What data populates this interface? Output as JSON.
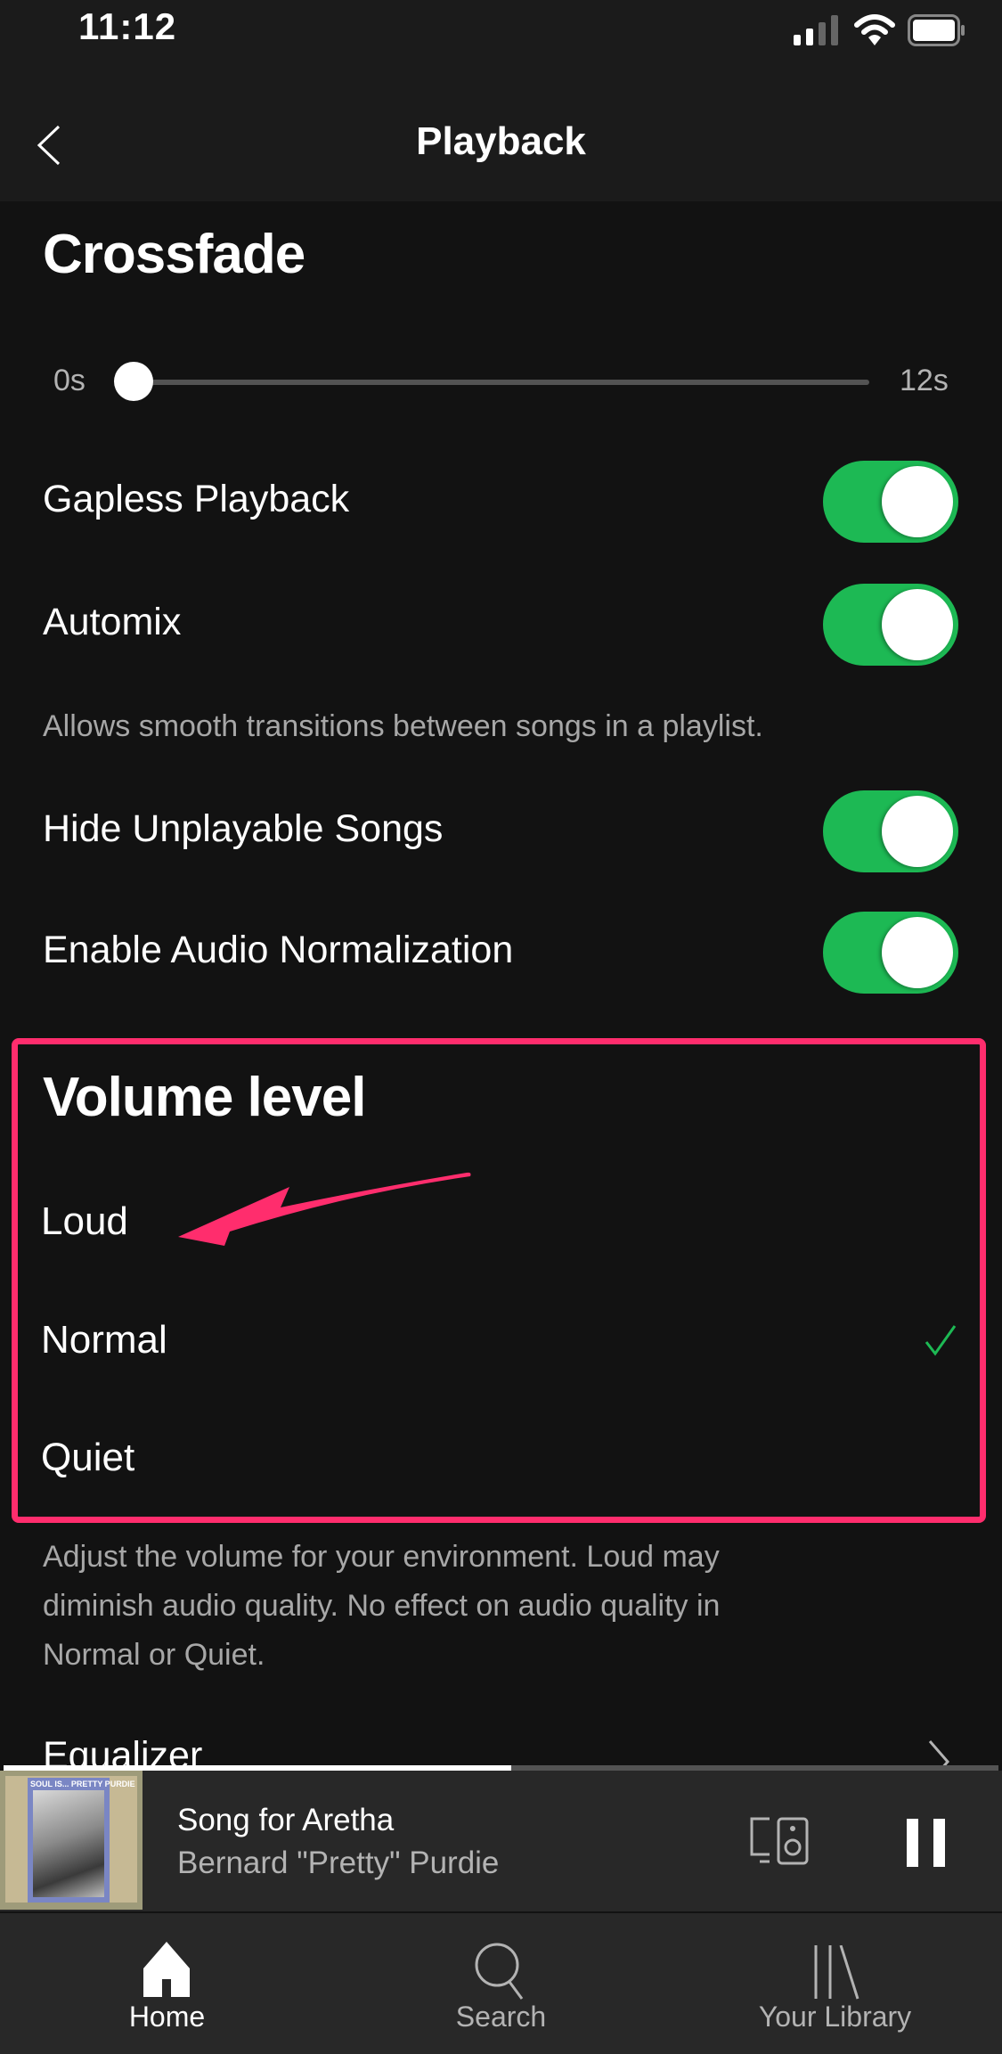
{
  "status_bar": {
    "time": "11:12",
    "icons": [
      "cellular-signal-icon",
      "wifi-icon",
      "battery-icon"
    ]
  },
  "nav": {
    "title": "Playback",
    "back_icon": "chevron-left-icon"
  },
  "crossfade": {
    "heading": "Crossfade",
    "min_label": "0s",
    "max_label": "12s",
    "value_seconds": 0,
    "max_seconds": 12
  },
  "toggles": [
    {
      "label": "Gapless Playback",
      "on": true
    },
    {
      "label": "Automix",
      "on": true,
      "description": "Allows smooth transitions between songs in a playlist."
    },
    {
      "label": "Hide Unplayable Songs",
      "on": true
    },
    {
      "label": "Enable Audio Normalization",
      "on": true
    }
  ],
  "volume_level": {
    "heading": "Volume level",
    "options": [
      {
        "label": "Loud",
        "selected": false
      },
      {
        "label": "Normal",
        "selected": true
      },
      {
        "label": "Quiet",
        "selected": false
      }
    ],
    "check_icon": "checkmark-icon",
    "description": "Adjust the volume for your environment. Loud may diminish audio quality. No effect on audio quality in Normal or Quiet.",
    "description_lines": [
      "Adjust the volume for your environment. Loud may",
      "diminish audio quality. No effect on audio quality in",
      "Normal or Quiet."
    ]
  },
  "annotation": {
    "color": "#ff2d6d",
    "arrow_target": "Loud"
  },
  "equalizer": {
    "label": "Equalizer",
    "icon": "chevron-right-icon"
  },
  "now_playing": {
    "progress_fraction": 0.51,
    "album_art_text": "SOUL IS... PRETTY PURDIE",
    "title": "Song for Aretha",
    "artist": "Bernard \"Pretty\" Purdie",
    "devices_icon": "devices-icon",
    "pause_icon": "pause-icon"
  },
  "tabs": [
    {
      "label": "Home",
      "icon": "home-icon",
      "active": true
    },
    {
      "label": "Search",
      "icon": "search-icon",
      "active": false
    },
    {
      "label": "Your Library",
      "icon": "library-icon",
      "active": false
    }
  ],
  "colors": {
    "accent_green": "#1db954",
    "background": "#121212",
    "header": "#1b1b1b",
    "player": "#282828",
    "annotation_pink": "#ff2d6d",
    "secondary_text": "#a7a7a7"
  }
}
